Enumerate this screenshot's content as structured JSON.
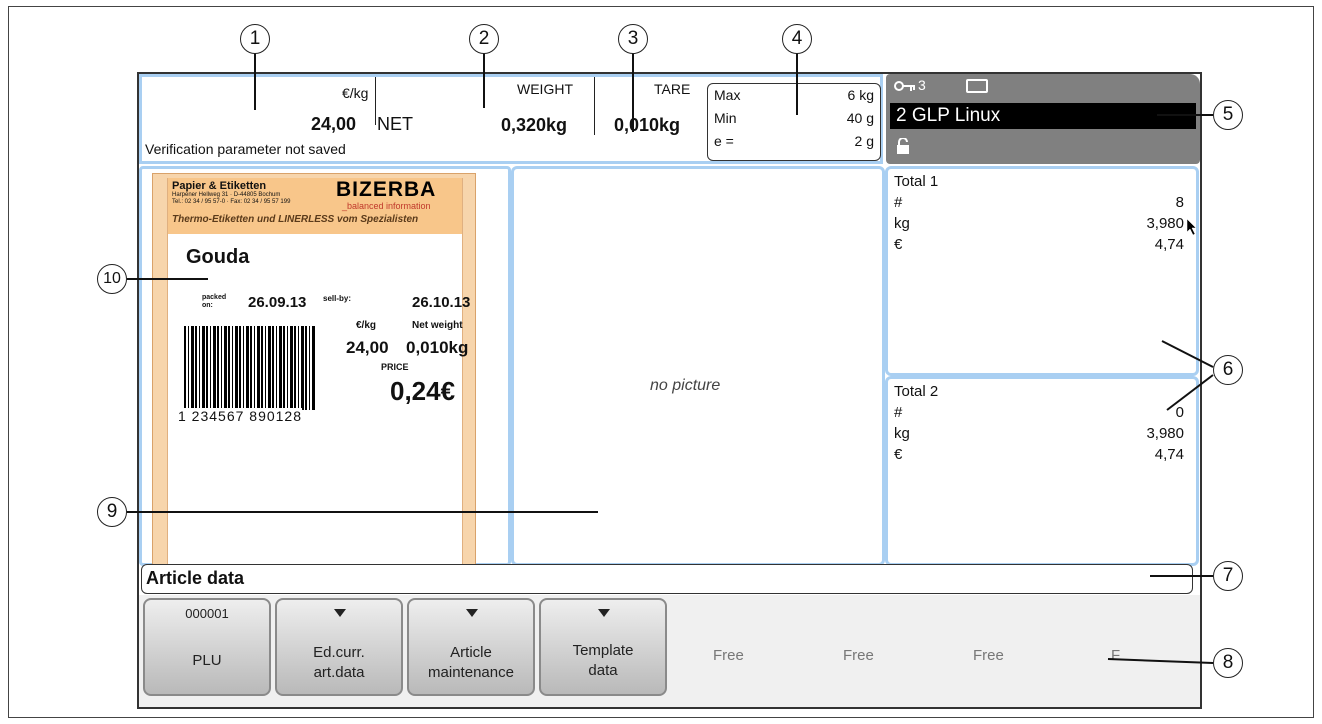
{
  "header": {
    "unit_price_label": "€/kg",
    "unit_price_value": "24,00",
    "net_label": "NET",
    "weight_label": "WEIGHT",
    "weight_value": "0,320kg",
    "tare_label": "TARE",
    "tare_value": "0,010kg",
    "verification_text": "Verification parameter not saved"
  },
  "limits": [
    {
      "label": "Max",
      "value": "6 kg"
    },
    {
      "label": "Min",
      "value": "40 g"
    },
    {
      "label": "e =",
      "value": "2 g"
    }
  ],
  "status": {
    "key_level": "3",
    "scale_name": "2 GLP Linux",
    "icons": [
      "key-icon",
      "display-icon",
      "lock-icon"
    ]
  },
  "label": {
    "vendor_name": "Papier & Etiketten",
    "vendor_address": "Harpener Hellweg 31 · D-44805 Bochum",
    "vendor_phone": "Tel.: 02 34 / 95 57-0 · Fax: 02 34 / 95 57 199",
    "brand": "BIZERBA",
    "brand_tagline": "_balanced information",
    "slogan": "Thermo-Etiketten und LINERLESS vom Spezialisten",
    "product": "Gouda",
    "packed_label": "packed on:",
    "packed_date": "26.09.13",
    "sellby_label": "sell-by:",
    "sellby_date": "26.10.13",
    "unit_label": "€/kg",
    "unit_price": "24,00",
    "net_weight_label": "Net weight",
    "net_weight": "0,010kg",
    "price_label": "PRICE",
    "price": "0,24€",
    "barcode_number": "1 234567 890128"
  },
  "picture_panel": {
    "placeholder": "no picture"
  },
  "totals": [
    {
      "title": "Total 1",
      "rows": [
        {
          "label": "#",
          "value": "8"
        },
        {
          "label": "kg",
          "value": "3,980"
        },
        {
          "label": "€",
          "value": "4,74"
        }
      ]
    },
    {
      "title": "Total 2",
      "rows": [
        {
          "label": "#",
          "value": "0"
        },
        {
          "label": "kg",
          "value": "3,980"
        },
        {
          "label": "€",
          "value": "4,74"
        }
      ]
    }
  ],
  "article_bar": {
    "label": "Article data"
  },
  "softkeys": [
    {
      "top": "000001",
      "label1": "PLU",
      "label2": ""
    },
    {
      "top": "",
      "label1": "Ed.curr.",
      "label2": "art.data"
    },
    {
      "top": "",
      "label1": "Article",
      "label2": "maintenance"
    },
    {
      "top": "",
      "label1": "Template",
      "label2": "data"
    }
  ],
  "free_slots": [
    "Free",
    "Free",
    "Free",
    "F"
  ],
  "callouts": [
    "1",
    "2",
    "3",
    "4",
    "5",
    "6",
    "7",
    "8",
    "9",
    "10"
  ],
  "colors": {
    "panel_border": "#a9cff2",
    "status_bg": "#808080",
    "label_orange": "#f8c68a",
    "brand_red": "#c0392b"
  }
}
